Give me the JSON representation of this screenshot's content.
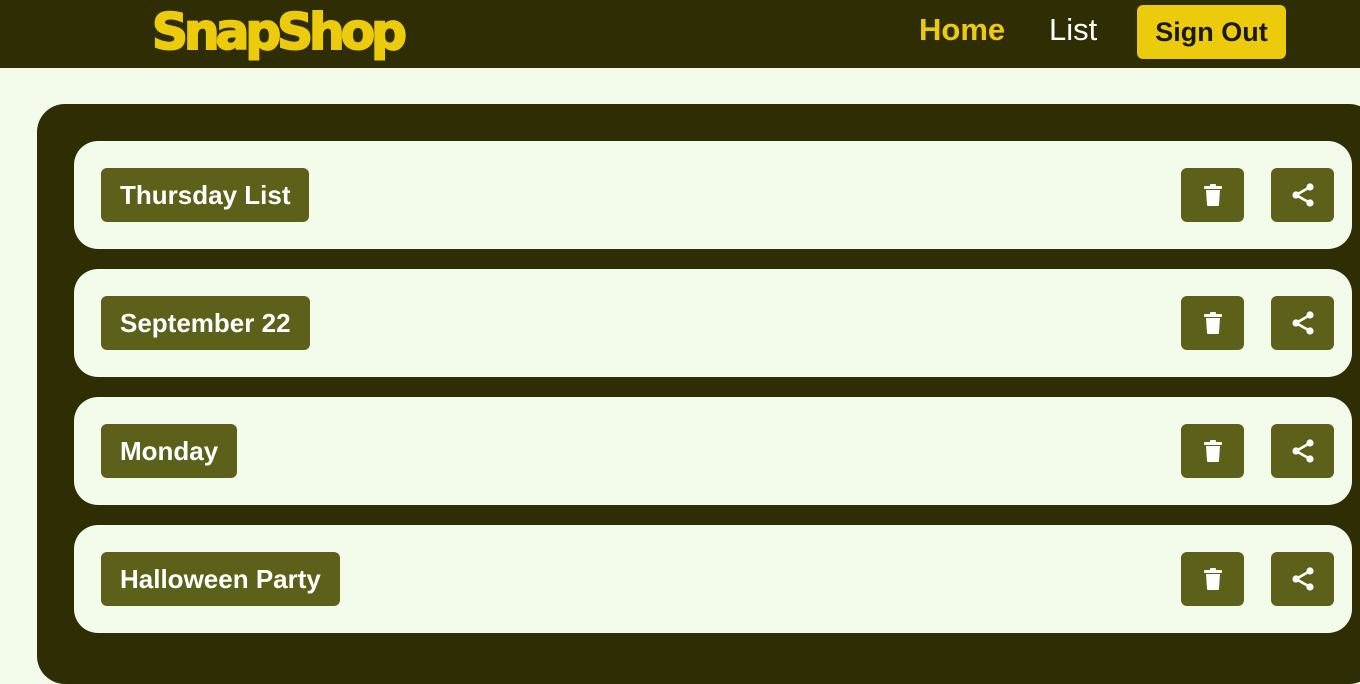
{
  "app": {
    "logo_text": "SnapShop",
    "brand_color": "#eccb0d",
    "nav_bg_color": "#2f2d04",
    "page_bg_color": "#f3fbea",
    "button_color": "#5c6018"
  },
  "nav": {
    "home_label": "Home",
    "list_label": "List",
    "signout_label": "Sign Out",
    "active_item": "Home"
  },
  "lists": [
    {
      "name": "Thursday List",
      "delete_icon": "trash-icon",
      "share_icon": "share-icon"
    },
    {
      "name": "September 22",
      "delete_icon": "trash-icon",
      "share_icon": "share-icon"
    },
    {
      "name": "Monday",
      "delete_icon": "trash-icon",
      "share_icon": "share-icon"
    },
    {
      "name": "Halloween Party",
      "delete_icon": "trash-icon",
      "share_icon": "share-icon"
    }
  ]
}
